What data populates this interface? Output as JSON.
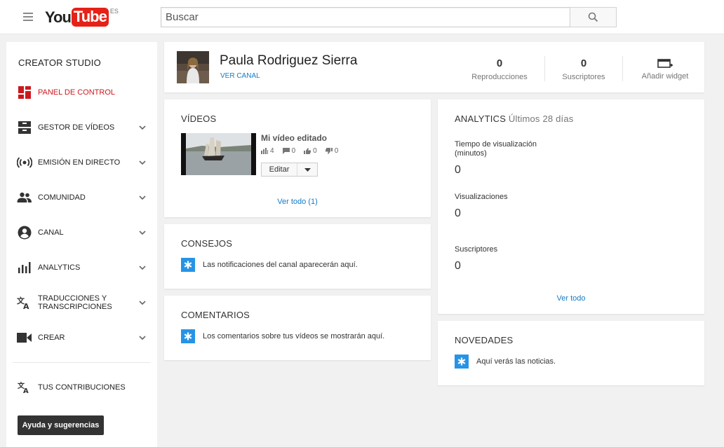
{
  "header": {
    "logo_you": "You",
    "logo_tube": "Tube",
    "region": "ES",
    "search_placeholder": "Buscar"
  },
  "sidebar": {
    "title": "CREATOR STUDIO",
    "items": [
      {
        "label": "PANEL DE CONTROL",
        "icon": "dashboard-icon",
        "active": true
      },
      {
        "label": "GESTOR DE VÍDEOS",
        "icon": "video-manager-icon"
      },
      {
        "label": "EMISIÓN EN DIRECTO",
        "icon": "live-broadcast-icon"
      },
      {
        "label": "COMUNIDAD",
        "icon": "community-icon"
      },
      {
        "label": "CANAL",
        "icon": "channel-icon"
      },
      {
        "label": "ANALYTICS",
        "icon": "analytics-icon"
      },
      {
        "label": "TRADUCCIONES Y",
        "label2": "TRANSCRIPCIONES",
        "icon": "translate-icon"
      },
      {
        "label": "CREAR",
        "icon": "camera-icon"
      }
    ],
    "contributions_label": "TUS CONTRIBUCIONES",
    "help_button": "Ayuda y sugerencias",
    "active_color": "#cc181e"
  },
  "profile": {
    "name": "Paula Rodriguez Sierra",
    "view_channel": "VER CANAL",
    "stats": [
      {
        "value": "0",
        "label": "Reproducciones"
      },
      {
        "value": "0",
        "label": "Suscriptores"
      }
    ],
    "add_widget": "Añadir widget"
  },
  "videos": {
    "title": "VÍDEOS",
    "item": {
      "title": "Mi vídeo editado",
      "views": "4",
      "comments": "0",
      "likes": "0",
      "dislikes": "0"
    },
    "edit_label": "Editar",
    "see_all": "Ver todo (1)"
  },
  "tips": {
    "title": "CONSEJOS",
    "text": "Las notificaciones del canal aparecerán aquí."
  },
  "comments": {
    "title": "COMENTARIOS",
    "text": "Los comentarios sobre tus vídeos se mostrarán aquí."
  },
  "analytics": {
    "title": "ANALYTICS",
    "subtitle": "Últimos 28 días",
    "metrics": [
      {
        "label": "Tiempo de visualización",
        "label2": "(minutos)",
        "value": "0"
      },
      {
        "label": "Visualizaciones",
        "value": "0"
      },
      {
        "label": "Suscriptores",
        "value": "0"
      }
    ],
    "see_all": "Ver todo"
  },
  "news": {
    "title": "NOVEDADES",
    "text": "Aquí verás las noticias."
  },
  "colors": {
    "accent_blue": "#167ac6",
    "icon_blue": "#2793e6",
    "brand_red": "#e62117"
  }
}
